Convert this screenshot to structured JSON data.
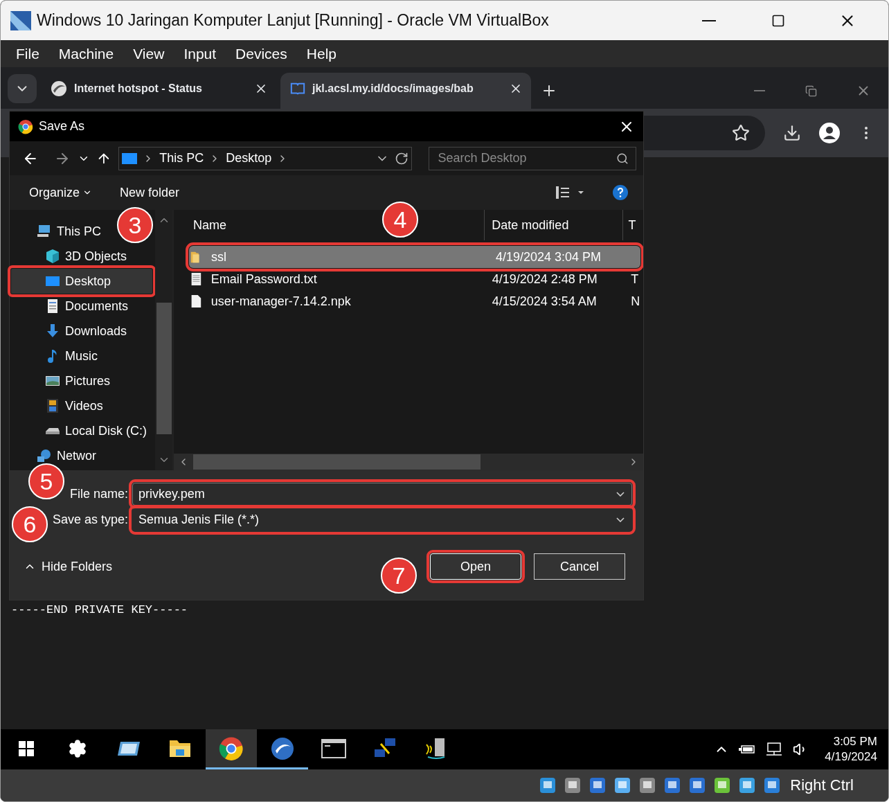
{
  "window": {
    "title": "Windows 10 Jaringan Komputer Lanjut [Running] - Oracle VM VirtualBox"
  },
  "menu": [
    "File",
    "Machine",
    "View",
    "Input",
    "Devices",
    "Help"
  ],
  "browser_tabs": [
    {
      "label": "Internet hotspot - Status",
      "selected": false,
      "kind": "hotspot"
    },
    {
      "label": "jkl.acsl.my.id/docs/images/bab",
      "selected": true,
      "kind": "book"
    }
  ],
  "dialog": {
    "title": "Save As",
    "breadcrumb": [
      "This PC",
      "Desktop"
    ],
    "search": {
      "placeholder": "Search Desktop"
    },
    "toolbar": [
      "Organize",
      "New folder"
    ],
    "nav": [
      {
        "label": "This PC",
        "kind": "pc",
        "selected": false,
        "children": [
          {
            "label": "3D Objects",
            "kind": "cube",
            "selected": false
          },
          {
            "label": "Desktop",
            "kind": "desktop",
            "selected": true
          },
          {
            "label": "Documents",
            "kind": "document",
            "selected": false
          },
          {
            "label": "Downloads",
            "kind": "download",
            "selected": false
          },
          {
            "label": "Music",
            "kind": "music",
            "selected": false
          },
          {
            "label": "Pictures",
            "kind": "pictures",
            "selected": false
          },
          {
            "label": "Videos",
            "kind": "videos",
            "selected": false
          },
          {
            "label": "Local Disk (C:)",
            "kind": "disk",
            "selected": false
          }
        ]
      },
      {
        "label": "Networ",
        "kind": "network",
        "selected": false
      }
    ],
    "columns": [
      "Name",
      "Date modified",
      "T"
    ],
    "files": [
      {
        "name": "ssl",
        "date": "4/19/2024 3:04 PM",
        "kind": "folder",
        "selected": true
      },
      {
        "name": "Email Password.txt",
        "date": "4/19/2024 2:48 PM",
        "column_3": "T",
        "kind": "text",
        "selected": false
      },
      {
        "name": "user-manager-7.14.2.npk",
        "date": "4/15/2024 3:54 AM",
        "column_3": "N",
        "kind": "file",
        "selected": false
      }
    ],
    "file_name_label": "File name:",
    "file_name": "privkey.pem",
    "type_label": "Save as type:",
    "save_as_type": "Semua Jenis File (*.*)",
    "hide_folders": "Hide Folders",
    "buttons": [
      "Open",
      "Cancel"
    ]
  },
  "terminal_text": "-----END PRIVATE KEY-----",
  "annotations": [
    {
      "label": "3"
    },
    {
      "label": "4"
    },
    {
      "label": "5"
    },
    {
      "label": "6"
    },
    {
      "label": "7"
    }
  ],
  "taskbar": {
    "apps": [
      {
        "kind": "start",
        "active": false,
        "running": false
      },
      {
        "kind": "settings",
        "active": false,
        "running": false
      },
      {
        "kind": "drive",
        "active": false,
        "running": false
      },
      {
        "kind": "explorer",
        "active": false,
        "running": false
      },
      {
        "kind": "chrome",
        "active": true,
        "running": true
      },
      {
        "kind": "winbox",
        "active": false,
        "running": true
      },
      {
        "kind": "terminal",
        "active": false,
        "running": false
      },
      {
        "kind": "network",
        "active": false,
        "running": false
      },
      {
        "kind": "server",
        "active": false,
        "running": false
      }
    ],
    "time": "3:05 PM",
    "date": "4/19/2024"
  },
  "status_bar": {
    "host_key": "Right Ctrl"
  }
}
